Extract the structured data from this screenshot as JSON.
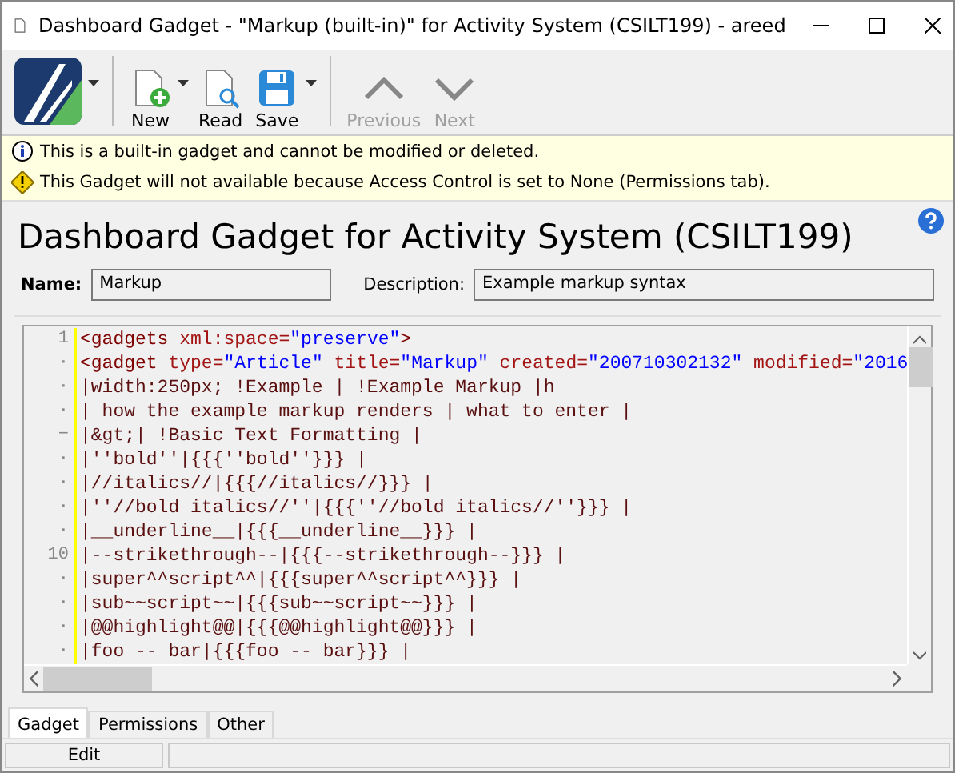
{
  "window": {
    "title": "Dashboard Gadget - \"Markup (built-in)\" for Activity System (CSILT199) - areed"
  },
  "toolbar": {
    "items": [
      {
        "kind": "logo"
      },
      {
        "kind": "button",
        "label": "New",
        "disabled": false,
        "dropdown": true
      },
      {
        "kind": "button",
        "label": "Read",
        "disabled": false,
        "dropdown": false
      },
      {
        "kind": "button",
        "label": "Save",
        "disabled": false,
        "dropdown": true
      },
      {
        "kind": "separator"
      },
      {
        "kind": "button",
        "label": "Previous",
        "disabled": true,
        "dropdown": false
      },
      {
        "kind": "button",
        "label": "Next",
        "disabled": true,
        "dropdown": false
      }
    ]
  },
  "notices": [
    {
      "kind": "info",
      "text": "This is a built-in gadget and cannot be modified or deleted."
    },
    {
      "kind": "warning",
      "text": "This Gadget will not available because Access Control is set to None (Permissions tab)."
    }
  ],
  "heading": "Dashboard Gadget for Activity System (CSILT199)",
  "fields": [
    {
      "label": "Name:",
      "value": "Markup"
    },
    {
      "label": "Description:",
      "value": "Example markup syntax"
    }
  ],
  "editor": {
    "lines": [
      {
        "gutter": "1",
        "segments": [
          {
            "kind": "tag",
            "text": "<gadgets "
          },
          {
            "kind": "attr",
            "text": "xml:space="
          },
          {
            "kind": "string",
            "text": "\"preserve\""
          },
          {
            "kind": "tag",
            "text": ">"
          }
        ]
      },
      {
        "gutter": "·",
        "segments": [
          {
            "kind": "tag",
            "text": "<gadget "
          },
          {
            "kind": "attr",
            "text": "type="
          },
          {
            "kind": "string",
            "text": "\"Article\""
          },
          {
            "kind": "attr",
            "text": " title="
          },
          {
            "kind": "string",
            "text": "\"Markup\""
          },
          {
            "kind": "attr",
            "text": " created="
          },
          {
            "kind": "string",
            "text": "\"200710302132\""
          },
          {
            "kind": "attr",
            "text": " modified="
          },
          {
            "kind": "string",
            "text": "\"2016"
          }
        ]
      },
      {
        "gutter": "·",
        "segments": [
          {
            "kind": "text",
            "text": "|width:250px; !Example | !Example Markup |h"
          }
        ]
      },
      {
        "gutter": "·",
        "segments": [
          {
            "kind": "text",
            "text": "| how the example markup renders | what to enter |"
          }
        ]
      },
      {
        "gutter": "−",
        "segments": [
          {
            "kind": "text",
            "text": "|&gt;| !Basic Text Formatting |"
          }
        ]
      },
      {
        "gutter": "·",
        "segments": [
          {
            "kind": "text",
            "text": "|''bold''|{{{''bold''}}} |"
          }
        ]
      },
      {
        "gutter": "·",
        "segments": [
          {
            "kind": "text",
            "text": "|//italics//|{{{//italics//}}} |"
          }
        ]
      },
      {
        "gutter": "·",
        "segments": [
          {
            "kind": "text",
            "text": "|''//bold italics//''|{{{''//bold italics//''}}} |"
          }
        ]
      },
      {
        "gutter": "·",
        "segments": [
          {
            "kind": "text",
            "text": "|__underline__|{{{__underline__}}} |"
          }
        ]
      },
      {
        "gutter": "10",
        "segments": [
          {
            "kind": "text",
            "text": "|--strikethrough--|{{{--strikethrough--}}} |"
          }
        ]
      },
      {
        "gutter": "·",
        "segments": [
          {
            "kind": "text",
            "text": "|super^^script^^|{{{super^^script^^}}} |"
          }
        ]
      },
      {
        "gutter": "·",
        "segments": [
          {
            "kind": "text",
            "text": "|sub~~script~~|{{{sub~~script~~}}} |"
          }
        ]
      },
      {
        "gutter": "·",
        "segments": [
          {
            "kind": "text",
            "text": "|@@highlight@@|{{{@@highlight@@}}} |"
          }
        ]
      },
      {
        "gutter": "·",
        "segments": [
          {
            "kind": "text",
            "text": "|foo -- bar|{{{foo -- bar}}} |"
          }
        ]
      }
    ]
  },
  "tabs": [
    {
      "label": "Gadget",
      "selected": true
    },
    {
      "label": "Permissions",
      "selected": false
    },
    {
      "label": "Other",
      "selected": false
    }
  ],
  "status_bar": {
    "mode": "Edit"
  }
}
